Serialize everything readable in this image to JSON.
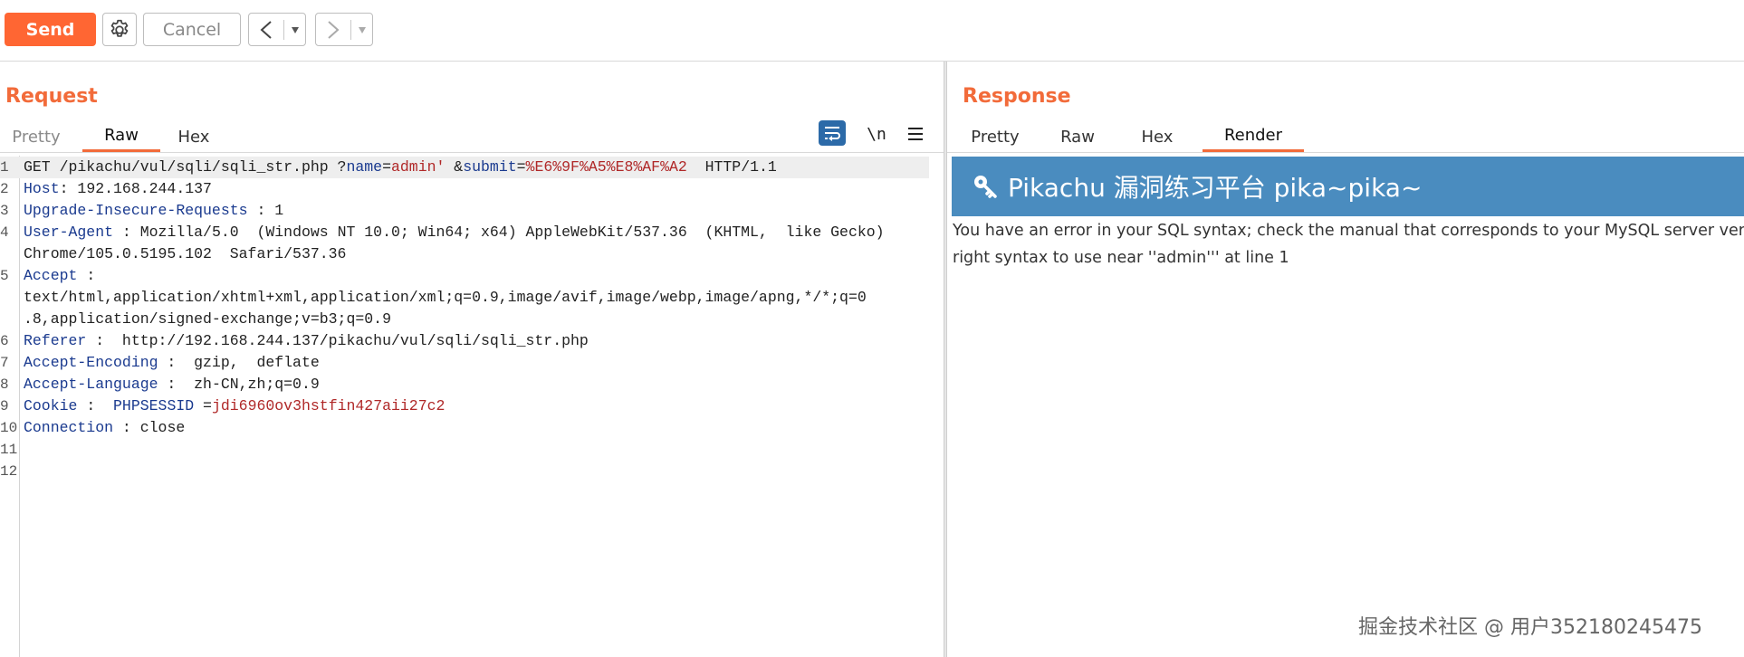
{
  "toolbar": {
    "send_label": "Send",
    "cancel_label": "Cancel",
    "back_glyph": "<",
    "forward_glyph": ">",
    "dropdown_glyph": "▾",
    "settings_icon": "gear-icon"
  },
  "request": {
    "title": "Request",
    "tabs": [
      {
        "label": "Pretty",
        "active": false
      },
      {
        "label": "Raw",
        "active": true
      },
      {
        "label": "Hex",
        "active": false
      }
    ],
    "tools": {
      "wrap_icon": "word-wrap-icon",
      "newline_label": "\\n",
      "menu_icon": "hamburger-menu-icon"
    },
    "lines": [
      {
        "n": "1",
        "parts": [
          {
            "t": "GET /pikachu/vul/sqli/sqli_str.php ?",
            "c": ""
          },
          {
            "t": "name",
            "c": "k"
          },
          {
            "t": "=",
            "c": ""
          },
          {
            "t": "admin'",
            "c": "v"
          },
          {
            "t": " &",
            "c": ""
          },
          {
            "t": "submit",
            "c": "k"
          },
          {
            "t": "=",
            "c": ""
          },
          {
            "t": "%E6%9F%A5%E8%AF%A2",
            "c": "v"
          },
          {
            "t": "  HTTP/1.1",
            "c": ""
          }
        ]
      },
      {
        "n": "2",
        "parts": [
          {
            "t": "Host",
            "c": "k"
          },
          {
            "t": ": 192.168.244.137",
            "c": ""
          }
        ]
      },
      {
        "n": "3",
        "parts": [
          {
            "t": "Upgrade-Insecure-Requests",
            "c": "k"
          },
          {
            "t": " : 1",
            "c": ""
          }
        ]
      },
      {
        "n": "4",
        "parts": [
          {
            "t": "User-Agent",
            "c": "k"
          },
          {
            "t": " : Mozilla/5.0  (Windows NT 10.0; Win64; x64) AppleWebKit/537.36  (KHTML,  like Gecko)",
            "c": ""
          }
        ]
      },
      {
        "n": "",
        "parts": [
          {
            "t": "Chrome/105.0.5195.102  Safari/537.36",
            "c": ""
          }
        ]
      },
      {
        "n": "5",
        "parts": [
          {
            "t": "Accept",
            "c": "k"
          },
          {
            "t": " :",
            "c": ""
          }
        ]
      },
      {
        "n": "",
        "parts": [
          {
            "t": "text/html,application/xhtml+xml,application/xml;q=0.9,image/avif,image/webp,image/apng,*/*;q=0",
            "c": ""
          }
        ]
      },
      {
        "n": "",
        "parts": [
          {
            "t": ".8,application/signed-exchange;v=b3;q=0.9",
            "c": ""
          }
        ]
      },
      {
        "n": "6",
        "parts": [
          {
            "t": "Referer",
            "c": "k"
          },
          {
            "t": " :  http://192.168.244.137/pikachu/vul/sqli/sqli_str.php",
            "c": ""
          }
        ]
      },
      {
        "n": "7",
        "parts": [
          {
            "t": "Accept-Encoding",
            "c": "k"
          },
          {
            "t": " :  gzip,  deflate",
            "c": ""
          }
        ]
      },
      {
        "n": "8",
        "parts": [
          {
            "t": "Accept-Language",
            "c": "k"
          },
          {
            "t": " :  zh-CN,zh;q=0.9",
            "c": ""
          }
        ]
      },
      {
        "n": "9",
        "parts": [
          {
            "t": "Cookie",
            "c": "k"
          },
          {
            "t": " :  ",
            "c": ""
          },
          {
            "t": "PHPSESSID",
            "c": "k"
          },
          {
            "t": " =",
            "c": ""
          },
          {
            "t": "jdi6960ov3hstfin427aii27c2",
            "c": "v"
          }
        ]
      },
      {
        "n": "10",
        "parts": [
          {
            "t": "Connection",
            "c": "k"
          },
          {
            "t": " : close",
            "c": ""
          }
        ]
      },
      {
        "n": "11",
        "parts": []
      },
      {
        "n": "12",
        "parts": []
      }
    ]
  },
  "response": {
    "title": "Response",
    "tabs": [
      {
        "label": "Pretty",
        "active": false
      },
      {
        "label": "Raw",
        "active": false
      },
      {
        "label": "Hex",
        "active": false
      },
      {
        "label": "Render",
        "active": true
      }
    ],
    "render": {
      "banner_text": "Pikachu 漏洞练习平台 pika~pika~",
      "error_line1": "You have an error in your SQL syntax; check the manual that corresponds to your MySQL server version for the",
      "error_line2": "right syntax to use near ''admin''' at line 1"
    }
  },
  "watermark": "掘金技术社区 @ 用户352180245475"
}
